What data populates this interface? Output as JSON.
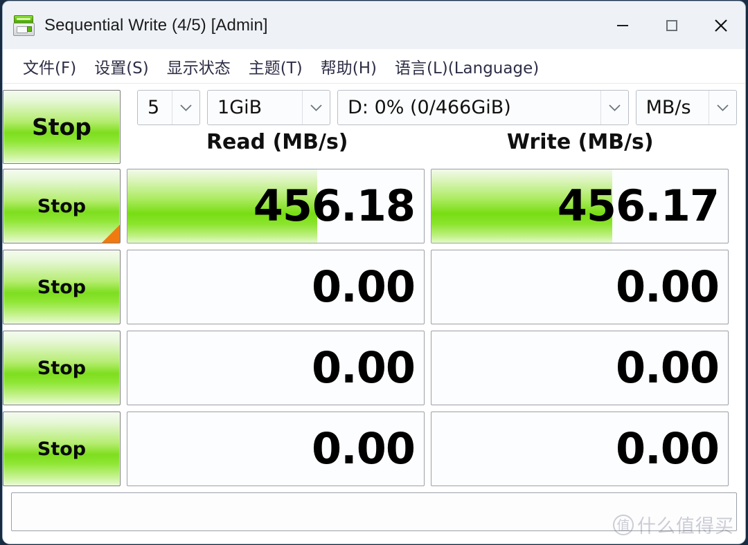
{
  "window": {
    "title": "Sequential Write (4/5) [Admin]",
    "app_icon": "disk-drive-icon",
    "controls": {
      "minimize": "minimize-icon",
      "maximize": "maximize-icon",
      "close": "close-icon"
    }
  },
  "menu": {
    "items": [
      {
        "label": "文件(F)"
      },
      {
        "label": "设置(S)"
      },
      {
        "label": "显示状态"
      },
      {
        "label": "主题(T)"
      },
      {
        "label": "帮助(H)"
      },
      {
        "label": "语言(L)(Language)"
      }
    ]
  },
  "settings": {
    "test_count": "5",
    "test_size": "1GiB",
    "target_drive": "D: 0% (0/466GiB)",
    "unit": "MB/s"
  },
  "columns": {
    "read": "Read (MB/s)",
    "write": "Write (MB/s)"
  },
  "buttons": {
    "all": "Stop",
    "row1": "Stop",
    "row2": "Stop",
    "row3": "Stop",
    "row4": "Stop"
  },
  "results": [
    {
      "read": "456.18",
      "write": "456.17",
      "read_fill_pct": 64,
      "write_fill_pct": 61
    },
    {
      "read": "0.00",
      "write": "0.00",
      "read_fill_pct": 0,
      "write_fill_pct": 0
    },
    {
      "read": "0.00",
      "write": "0.00",
      "read_fill_pct": 0,
      "write_fill_pct": 0
    },
    {
      "read": "0.00",
      "write": "0.00",
      "read_fill_pct": 0,
      "write_fill_pct": 0
    }
  ],
  "status": {
    "text": ""
  },
  "watermark": {
    "mark": "值",
    "text": "什么值得买"
  },
  "colors": {
    "accent_green": "#7ede1e",
    "warning_orange": "#f07a10",
    "titlebar": "#eef2f7",
    "menu_text": "#2e2e46"
  }
}
